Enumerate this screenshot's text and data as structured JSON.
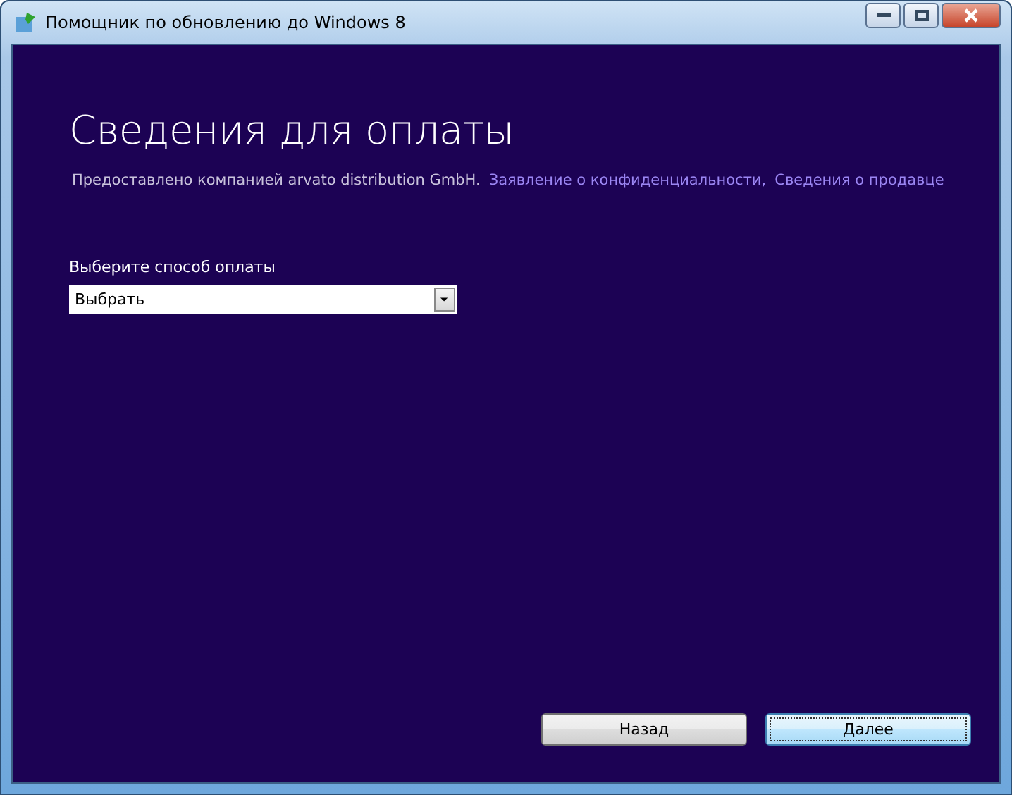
{
  "window": {
    "title": "Помощник по обновлению до Windows 8"
  },
  "heading": "Сведения для оплаты",
  "provider": {
    "text": "Предоставлено компанией arvato distribution GmbH.",
    "links": [
      "Заявление о конфиденциальности,",
      "Сведения о продавце"
    ]
  },
  "payment": {
    "label": "Выберите способ оплаты",
    "value": "Выбрать"
  },
  "buttons": [
    {
      "label": "Назад",
      "focused": false
    },
    {
      "label": "Далее",
      "focused": true
    }
  ]
}
